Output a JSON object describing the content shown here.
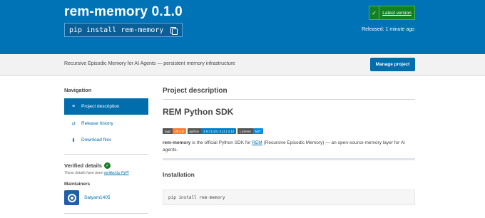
{
  "header": {
    "package_title": "rem-memory 0.1.0",
    "pip_command": "pip install rem-memory",
    "latest_check": "✓",
    "latest_label": "Latest version",
    "released": "Released: 1 minute ago"
  },
  "subbar": {
    "summary": "Recursive Episodic Memory for AI Agents — persistent memory infrastructure",
    "manage_label": "Manage project"
  },
  "sidebar": {
    "heading": "Navigation",
    "items": [
      {
        "icon": "≡",
        "label": "Project description"
      },
      {
        "icon": "↺",
        "label": "Release history"
      },
      {
        "icon": "⬇",
        "label": "Download files"
      }
    ],
    "verified_heading": "Verified details",
    "verified_check": "✓",
    "verified_note_prefix": "These details have been ",
    "verified_note_link": "verified by PyPI",
    "maintainers_heading": "Maintainers",
    "maintainer_name": "Satyam1405"
  },
  "main": {
    "heading": "Project description",
    "sdk_title": "REM Python SDK",
    "badges": [
      {
        "left": "pypi",
        "right": "v0.1.0"
      },
      {
        "left": "python",
        "right": "3.9 | 3.10 | 3.11 | 3.12"
      },
      {
        "left": "License",
        "right": "MIT"
      }
    ],
    "desc_bold": "rem-memory",
    "desc_mid": " is the official Python SDK for ",
    "desc_link": "REM",
    "desc_rest": " (Recursive Episodic Memory) — an open-source memory layer for AI agents.",
    "install_heading": "Installation",
    "install_code": "pip install rem-memory"
  },
  "colors": {
    "banner": "#0073b7",
    "accent": "#006dad",
    "verified_green": "#148024"
  }
}
